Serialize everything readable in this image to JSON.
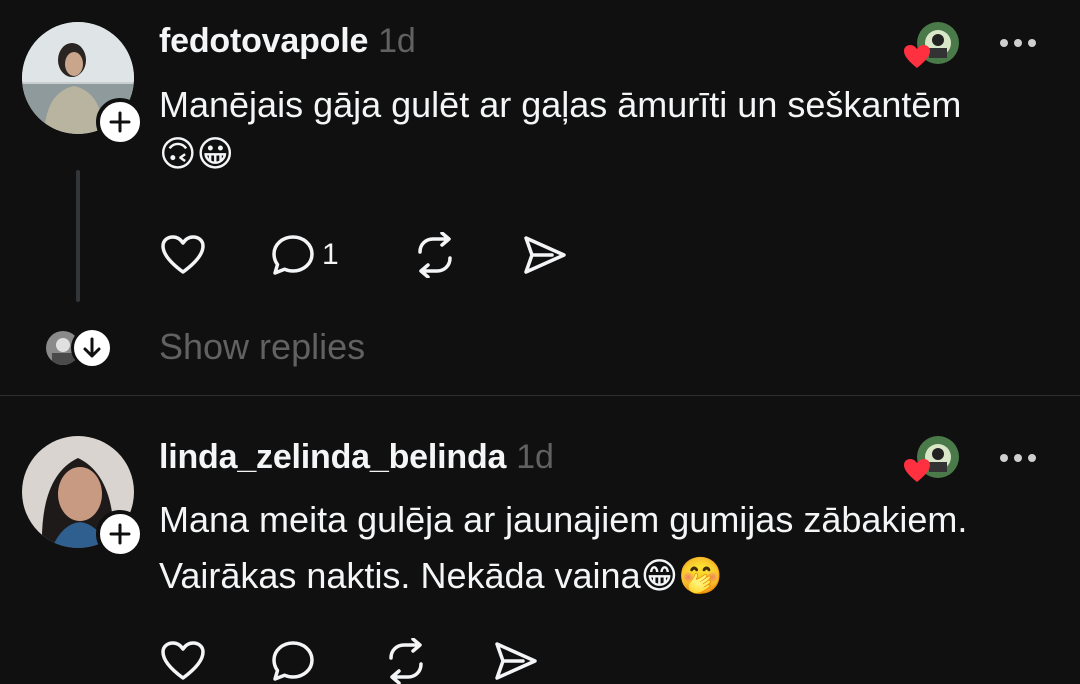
{
  "posts": [
    {
      "username": "fedotovapole",
      "time": "1d",
      "lines": [
        "Manējais gāja gulēt ar gaļas āmurīti un seškantēm"
      ],
      "emoji_line": "🙃😀",
      "reply_count": "1",
      "show_replies": "Show replies"
    },
    {
      "username": "linda_zelinda_belinda",
      "time": "1d",
      "lines": [
        "Mana meita gulēja ar jaunajiem gumijas zābakiem.",
        "Vairākas naktis. Nekāda vaina"
      ],
      "emoji_line": "😁🤭"
    }
  ],
  "icons": {
    "like": "heart-icon",
    "reply": "comment-icon",
    "repost": "repost-icon",
    "share": "send-icon",
    "more": "more-icon",
    "follow": "plus-icon",
    "show_replies": "arrow-down-icon"
  },
  "colors": {
    "background": "#101010",
    "text": "#f3f5f7",
    "muted": "#616161",
    "heart": "#ff3040"
  }
}
